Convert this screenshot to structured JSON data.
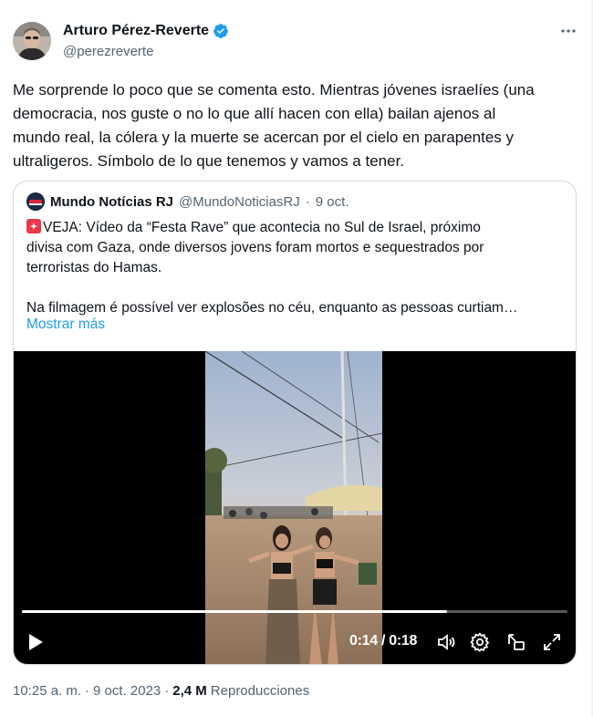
{
  "author": {
    "name": "Arturo Pérez-Reverte",
    "handle": "@perezreverte",
    "verified": true
  },
  "icons": {
    "verified": "verified-badge-icon",
    "more": "more-horizontal-icon",
    "play": "play-icon",
    "volume": "volume-icon",
    "settings": "settings-gear-icon",
    "pip": "picture-in-picture-icon",
    "fullscreen": "fullscreen-icon",
    "siren": "siren-emoji"
  },
  "tweet": {
    "lines": [
      "Me sorprende lo poco que se comenta esto. Mientras jóvenes israelíes (una",
      "democracia, nos guste o no lo que allí hacen con ella) bailan ajenos al",
      "mundo real, la cólera y la muerte se acercan por el cielo en parapentes y",
      "ultraligeros. Símbolo de lo que tenemos y vamos a tener."
    ]
  },
  "quote": {
    "name": "Mundo Notícias RJ",
    "handle": "@MundoNoticiasRJ",
    "separator": "·",
    "date": "9 oct.",
    "lines": [
      "VEJA: Vídeo da “Festa Rave” que acontecia no Sul de Israel, próximo",
      "divisa com Gaza, onde diversos jovens foram mortos e sequestrados por",
      "terroristas do Hamas."
    ],
    "line_after": "Na filmagem é possível ver explosões no céu, enquanto as pessoas curtiam…",
    "show_more": "Mostrar más"
  },
  "video": {
    "time": "0:14 / 0:18",
    "progress": 0.78
  },
  "meta": {
    "time": "10:25 a. m.",
    "dot1": "·",
    "date": "9 oct. 2023",
    "dot2": "·",
    "views_count": "2,4 M",
    "views_label": "Reproducciones"
  },
  "colors": {
    "text": "#0f1419",
    "secondary": "#536471",
    "link": "#1d9bf0",
    "border": "#cfd9de"
  }
}
